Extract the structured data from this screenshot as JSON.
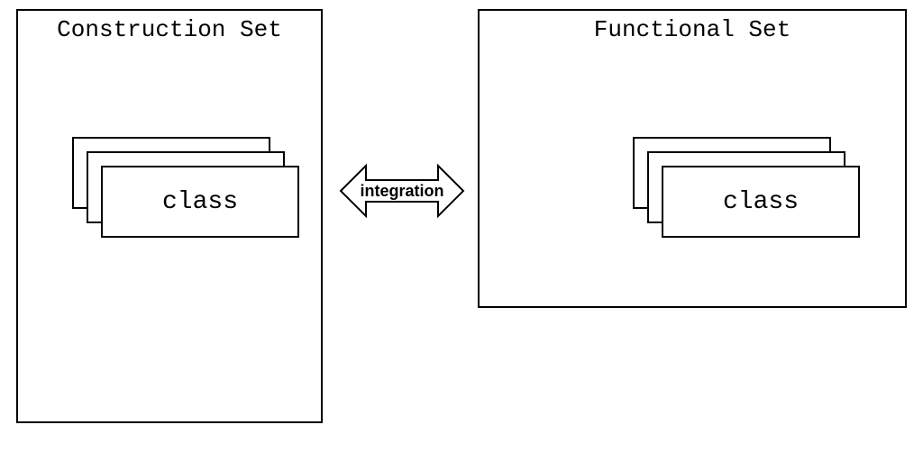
{
  "diagram": {
    "left_set": {
      "title": "Construction Set",
      "class_label": "class"
    },
    "right_set": {
      "title": "Functional Set",
      "class_label": "class"
    },
    "arrow_label": "integration"
  }
}
